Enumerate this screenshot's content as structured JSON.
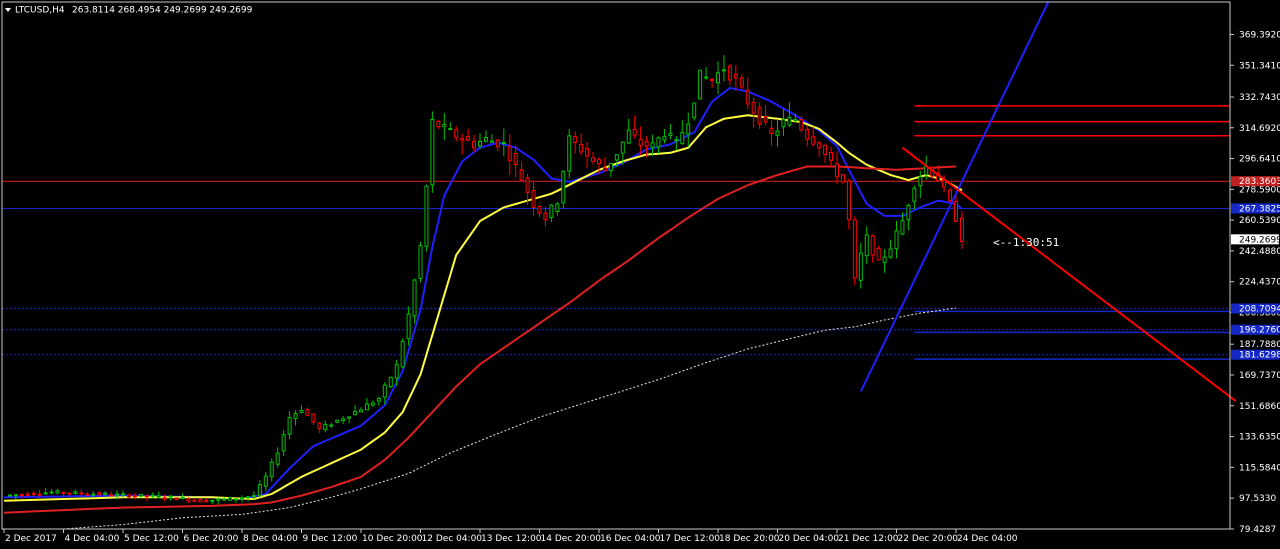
{
  "header": {
    "symbol": "LTCUSD,H4",
    "ohlc": "263.8114 268.4954 249.2699 249.2699"
  },
  "countdown": "<--1:30:51",
  "colors": {
    "background": "#000000",
    "frame": "#c8c8c8",
    "bull": "#00c000",
    "bear": "#ff0000",
    "ma_fast": "#1e20ff",
    "ma_mid": "#ffff40",
    "ma_slow": "#e02020",
    "ma_long": "#e8e8e8",
    "tag_red": "#c02020",
    "tag_blue": "#1428c8",
    "current_price_tag": "#ffffff"
  },
  "chart_data": {
    "type": "candlestick",
    "timeframe": "H4",
    "bars_total": 180,
    "ylim": [
      79.4287,
      388.43
    ],
    "y_ticks": [
      "369.3920",
      "351.3410",
      "332.7430",
      "314.6920",
      "296.6410",
      "278.5900",
      "260.5390",
      "242.4880",
      "224.4370",
      "206.3860",
      "187.7880",
      "169.7370",
      "151.6860",
      "133.6350",
      "115.5840",
      "97.5330",
      "79.4287"
    ],
    "x_ticks": [
      {
        "bar": 0,
        "label": "2 Dec 2017"
      },
      {
        "bar": 10,
        "label": "4 Dec 04:00"
      },
      {
        "bar": 20,
        "label": "5 Dec 12:00"
      },
      {
        "bar": 30,
        "label": "6 Dec 20:00"
      },
      {
        "bar": 40,
        "label": "8 Dec 04:00"
      },
      {
        "bar": 50,
        "label": "9 Dec 12:00"
      },
      {
        "bar": 60,
        "label": "10 Dec 20:00"
      },
      {
        "bar": 70,
        "label": "12 Dec 04:00"
      },
      {
        "bar": 80,
        "label": "13 Dec 12:00"
      },
      {
        "bar": 90,
        "label": "14 Dec 20:00"
      },
      {
        "bar": 100,
        "label": "16 Dec 04:00"
      },
      {
        "bar": 110,
        "label": "17 Dec 12:00"
      },
      {
        "bar": 120,
        "label": "18 Dec 20:00"
      },
      {
        "bar": 130,
        "label": "20 Dec 04:00"
      },
      {
        "bar": 140,
        "label": "21 Dec 12:00"
      },
      {
        "bar": 150,
        "label": "22 Dec 20:00"
      },
      {
        "bar": 160,
        "label": "24 Dec 04:00"
      }
    ],
    "price_path": [
      [
        0,
        99
      ],
      [
        8,
        101
      ],
      [
        15,
        100
      ],
      [
        22,
        99
      ],
      [
        28,
        98
      ],
      [
        33,
        96
      ],
      [
        38,
        97
      ],
      [
        42,
        99
      ],
      [
        44,
        110
      ],
      [
        46,
        125
      ],
      [
        48,
        145
      ],
      [
        50,
        150
      ],
      [
        53,
        138
      ],
      [
        56,
        143
      ],
      [
        60,
        150
      ],
      [
        63,
        156
      ],
      [
        66,
        175
      ],
      [
        68,
        205
      ],
      [
        70,
        245
      ],
      [
        71,
        280
      ],
      [
        72,
        318
      ],
      [
        74,
        314
      ],
      [
        76,
        310
      ],
      [
        79,
        305
      ],
      [
        81,
        308
      ],
      [
        84,
        305
      ],
      [
        87,
        285
      ],
      [
        89,
        270
      ],
      [
        91,
        262
      ],
      [
        93,
        272
      ],
      [
        95,
        308
      ],
      [
        97,
        302
      ],
      [
        99,
        295
      ],
      [
        101,
        290
      ],
      [
        103,
        300
      ],
      [
        105,
        312
      ],
      [
        107,
        305
      ],
      [
        109,
        304
      ],
      [
        111,
        312
      ],
      [
        113,
        305
      ],
      [
        115,
        320
      ],
      [
        117,
        345
      ],
      [
        119,
        343
      ],
      [
        121,
        350
      ],
      [
        123,
        342
      ],
      [
        125,
        330
      ],
      [
        127,
        320
      ],
      [
        129,
        310
      ],
      [
        131,
        318
      ],
      [
        133,
        320
      ],
      [
        135,
        310
      ],
      [
        137,
        305
      ],
      [
        139,
        293
      ],
      [
        141,
        283
      ],
      [
        142,
        260
      ],
      [
        143,
        225
      ],
      [
        144,
        240
      ],
      [
        145,
        250
      ],
      [
        147,
        235
      ],
      [
        149,
        245
      ],
      [
        151,
        260
      ],
      [
        153,
        282
      ],
      [
        155,
        292
      ],
      [
        157,
        285
      ],
      [
        159,
        270
      ],
      [
        160,
        262
      ],
      [
        161,
        250
      ]
    ],
    "moving_averages": [
      {
        "name": "fast",
        "color": "#1e20ff",
        "width": 2,
        "dash": false,
        "points": [
          [
            0,
            98
          ],
          [
            20,
            99
          ],
          [
            35,
            98
          ],
          [
            40,
            97
          ],
          [
            44,
            100
          ],
          [
            48,
            115
          ],
          [
            52,
            128
          ],
          [
            56,
            134
          ],
          [
            60,
            140
          ],
          [
            64,
            152
          ],
          [
            67,
            172
          ],
          [
            70,
            208
          ],
          [
            72,
            245
          ],
          [
            74,
            275
          ],
          [
            77,
            295
          ],
          [
            80,
            303
          ],
          [
            83,
            306
          ],
          [
            86,
            303
          ],
          [
            89,
            296
          ],
          [
            92,
            285
          ],
          [
            95,
            283
          ],
          [
            100,
            288
          ],
          [
            104,
            294
          ],
          [
            108,
            302
          ],
          [
            112,
            305
          ],
          [
            116,
            312
          ],
          [
            119,
            330
          ],
          [
            122,
            338
          ],
          [
            125,
            336
          ],
          [
            129,
            330
          ],
          [
            133,
            322
          ],
          [
            137,
            313
          ],
          [
            140,
            304
          ],
          [
            142,
            290
          ],
          [
            145,
            270
          ],
          [
            148,
            263
          ],
          [
            151,
            263
          ],
          [
            154,
            268
          ],
          [
            157,
            272
          ],
          [
            160,
            270
          ],
          [
            161,
            267
          ]
        ]
      },
      {
        "name": "mid",
        "color": "#ffff40",
        "width": 2,
        "dash": false,
        "points": [
          [
            0,
            96
          ],
          [
            20,
            98
          ],
          [
            35,
            98
          ],
          [
            42,
            97
          ],
          [
            45,
            100
          ],
          [
            50,
            110
          ],
          [
            55,
            118
          ],
          [
            60,
            126
          ],
          [
            64,
            136
          ],
          [
            67,
            148
          ],
          [
            70,
            170
          ],
          [
            73,
            205
          ],
          [
            76,
            240
          ],
          [
            80,
            260
          ],
          [
            84,
            268
          ],
          [
            88,
            272
          ],
          [
            92,
            276
          ],
          [
            96,
            283
          ],
          [
            100,
            290
          ],
          [
            104,
            295
          ],
          [
            108,
            299
          ],
          [
            112,
            300
          ],
          [
            115,
            303
          ],
          [
            118,
            315
          ],
          [
            121,
            320
          ],
          [
            125,
            322
          ],
          [
            130,
            320
          ],
          [
            134,
            318
          ],
          [
            137,
            314
          ],
          [
            140,
            306
          ],
          [
            142,
            300
          ],
          [
            145,
            293
          ],
          [
            149,
            287
          ],
          [
            152,
            284
          ],
          [
            155,
            287
          ],
          [
            158,
            284
          ],
          [
            161,
            278
          ]
        ]
      },
      {
        "name": "slow",
        "color": "#e02020",
        "width": 2,
        "dash": false,
        "points": [
          [
            0,
            89
          ],
          [
            20,
            92
          ],
          [
            35,
            93
          ],
          [
            42,
            94
          ],
          [
            45,
            95
          ],
          [
            50,
            99
          ],
          [
            55,
            104
          ],
          [
            60,
            110
          ],
          [
            64,
            120
          ],
          [
            68,
            133
          ],
          [
            72,
            148
          ],
          [
            76,
            163
          ],
          [
            80,
            176
          ],
          [
            85,
            188
          ],
          [
            90,
            200
          ],
          [
            95,
            212
          ],
          [
            100,
            225
          ],
          [
            105,
            237
          ],
          [
            110,
            250
          ],
          [
            115,
            262
          ],
          [
            120,
            273
          ],
          [
            125,
            281
          ],
          [
            130,
            287
          ],
          [
            135,
            292
          ],
          [
            140,
            292
          ],
          [
            145,
            291
          ],
          [
            150,
            290
          ],
          [
            155,
            291
          ],
          [
            160,
            292
          ]
        ]
      },
      {
        "name": "long",
        "color": "#e8e8e8",
        "width": 1,
        "dash": true,
        "points": [
          [
            10,
            79.4
          ],
          [
            20,
            82
          ],
          [
            30,
            86
          ],
          [
            40,
            88
          ],
          [
            48,
            92
          ],
          [
            55,
            98
          ],
          [
            60,
            103
          ],
          [
            68,
            112
          ],
          [
            75,
            124
          ],
          [
            82,
            134
          ],
          [
            90,
            145
          ],
          [
            100,
            156
          ],
          [
            110,
            167
          ],
          [
            118,
            177
          ],
          [
            125,
            185
          ],
          [
            132,
            191
          ],
          [
            138,
            196
          ],
          [
            143,
            198
          ],
          [
            148,
            202
          ],
          [
            154,
            206
          ],
          [
            160,
            209
          ]
        ]
      }
    ],
    "horizontal_lines": [
      {
        "price": 283.3603,
        "tag": "283.3603",
        "color": "#e02020",
        "style": "solid",
        "full_width": true
      },
      {
        "price": 267.3825,
        "tag": "267.3825",
        "color": "#1428c8",
        "style": "solid",
        "full_width": true
      },
      {
        "price": 208.7094,
        "tag": "208.7094",
        "color": "#1428c8",
        "style": "dotted",
        "full_width": true
      },
      {
        "price": 196.276,
        "tag": "196.2760",
        "color": "#1428c8",
        "style": "dotted",
        "full_width": true
      },
      {
        "price": 181.6298,
        "tag": "181.6298",
        "color": "#1428c8",
        "style": "dotted",
        "full_width": true
      }
    ],
    "level_segments": [
      {
        "price": 327.5,
        "color": "#ff0000",
        "from_bar": 153
      },
      {
        "price": 318.3,
        "color": "#ff0000",
        "from_bar": 153
      },
      {
        "price": 310.0,
        "color": "#ff0000",
        "from_bar": 153
      },
      {
        "price": 207.0,
        "color": "#1428c8",
        "from_bar": 153
      },
      {
        "price": 194.7,
        "color": "#1428c8",
        "from_bar": 153
      },
      {
        "price": 179.0,
        "color": "#1428c8",
        "from_bar": 153
      }
    ],
    "trendlines": [
      {
        "from": [
          144,
          160
        ],
        "to": [
          175.5,
          388.4
        ],
        "color": "#1e20ff",
        "width": 2
      },
      {
        "from": [
          151,
          303
        ],
        "to": [
          207,
          154.5
        ],
        "color": "#ff0000",
        "width": 2
      }
    ],
    "current_price": {
      "price": 249.2699,
      "tag": "249.2699"
    }
  }
}
